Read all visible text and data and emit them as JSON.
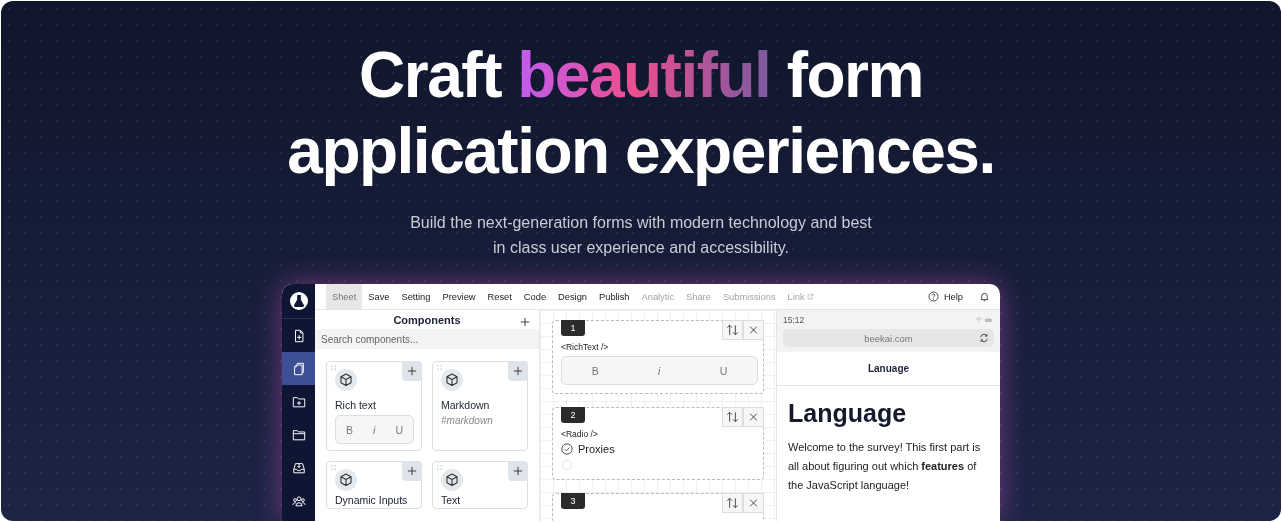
{
  "hero": {
    "headline": [
      [
        {
          "text": "Craft ",
          "highlight": false
        },
        {
          "text": "beautiful",
          "highlight": true
        },
        {
          "text": " form",
          "highlight": false
        }
      ],
      [
        {
          "text": "application experiences.",
          "highlight": false
        }
      ]
    ],
    "subtitle": [
      "Build the next-generation forms with modern technology and best",
      "in class user experience and accessibility."
    ]
  },
  "app": {
    "sidebar": {
      "items": [
        {
          "selected": false
        },
        {
          "selected": true
        },
        {
          "selected": false
        },
        {
          "selected": false
        },
        {
          "selected": false
        },
        {
          "selected": false
        }
      ]
    },
    "menu": [
      {
        "label": "Sheet",
        "selected": true,
        "disabled": false,
        "external": false
      },
      {
        "label": "Save",
        "selected": false,
        "disabled": false,
        "external": false
      },
      {
        "label": "Setting",
        "selected": false,
        "disabled": false,
        "external": false
      },
      {
        "label": "Preview",
        "selected": false,
        "disabled": false,
        "external": false
      },
      {
        "label": "Reset",
        "selected": false,
        "disabled": false,
        "external": false
      },
      {
        "label": "Code",
        "selected": false,
        "disabled": false,
        "external": false
      },
      {
        "label": "Design",
        "selected": false,
        "disabled": false,
        "external": false
      },
      {
        "label": "Publish",
        "selected": false,
        "disabled": false,
        "external": false
      },
      {
        "label": "Analytic",
        "selected": false,
        "disabled": true,
        "external": false
      },
      {
        "label": "Share",
        "selected": false,
        "disabled": true,
        "external": false
      },
      {
        "label": "Submissions",
        "selected": false,
        "disabled": true,
        "external": false
      },
      {
        "label": "Link",
        "selected": false,
        "disabled": true,
        "external": true
      }
    ],
    "help": "Help",
    "components": {
      "title": "Components",
      "search": {
        "placeholder": "Search components..."
      },
      "cards": [
        {
          "title": "Rich text",
          "kind": "format",
          "buttons": [
            "B",
            "i",
            "U"
          ]
        },
        {
          "title": "Markdown",
          "kind": "hint",
          "hint": "#markdown"
        },
        {
          "title": "Dynamic Inputs",
          "kind": "none"
        },
        {
          "title": "Text",
          "kind": "none"
        }
      ]
    },
    "canvas": {
      "blocks": [
        {
          "number": "1",
          "tag": "<RichText />",
          "kind": "richtext",
          "buttons": [
            "B",
            "i",
            "U"
          ]
        },
        {
          "number": "2",
          "tag": "<Radio />",
          "kind": "radio",
          "options": [
            {
              "label": "Proxies",
              "checked": true
            },
            {
              "checked": false
            }
          ]
        },
        {
          "number": "3",
          "kind": "none"
        }
      ]
    },
    "preview": {
      "time": "15:12",
      "url": "beekai.com",
      "page_title": "Lanuage",
      "heading": "Language",
      "paragraph": "Welcome to the survey! This first part is all about figuring out which **features** of the JavaScript language!"
    }
  }
}
